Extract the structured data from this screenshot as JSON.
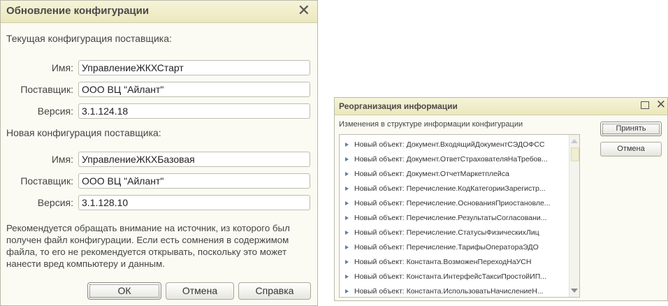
{
  "update_dialog": {
    "title": "Обновление конфигурации",
    "close_glyph": "✕",
    "current": {
      "section_label": "Текущая конфигурация поставщика:",
      "name_label": "Имя:",
      "name_value": "УправлениеЖКХСтарт",
      "vendor_label": "Поставщик:",
      "vendor_value": "ООО ВЦ \"Айлант\"",
      "version_label": "Версия:",
      "version_value": "3.1.124.18"
    },
    "new": {
      "section_label": "Новая конфигурация поставщика:",
      "name_label": "Имя:",
      "name_value": "УправлениеЖКХБазовая",
      "vendor_label": "Поставщик:",
      "vendor_value": "ООО ВЦ \"Айлант\"",
      "version_label": "Версия:",
      "version_value": "3.1.128.10"
    },
    "note": "Рекомендуется обращать внимание на источник, из которого был получен файл конфигурации. Если есть сомнения в содержимом файла, то его не рекомендуется открывать, поскольку это может нанести вред компьютеру и данным.",
    "buttons": {
      "ok": "ОК",
      "cancel": "Отмена",
      "help": "Справка"
    }
  },
  "reorg_dialog": {
    "title": "Реорганизация информации",
    "close_glyph": "✕",
    "subtitle": "Изменения в структуре информации конфигурации",
    "items": [
      "Новый объект: Документ.ВходящийДокументСЭДОФСС",
      "Новый объект: Документ.ОтветСтрахователяНаТребов...",
      "Новый объект: Документ.ОтчетМаркетплейса",
      "Новый объект: Перечисление.КодКатегорииЗарегистр...",
      "Новый объект: Перечисление.ОснованияПриостановле...",
      "Новый объект: Перечисление.РезультатыСогласовани...",
      "Новый объект: Перечисление.СтатусыФизическихЛиц",
      "Новый объект: Перечисление.ТарифыОператораЭДО",
      "Новый объект: Константа.ВозможенПереходНаУСН",
      "Новый объект: Константа.ИнтерфейсТаксиПростойИП...",
      "Новый объект: Константа.ИспользоватьНачислениеН..."
    ],
    "buttons": {
      "accept": "Принять",
      "cancel": "Отмена"
    }
  }
}
